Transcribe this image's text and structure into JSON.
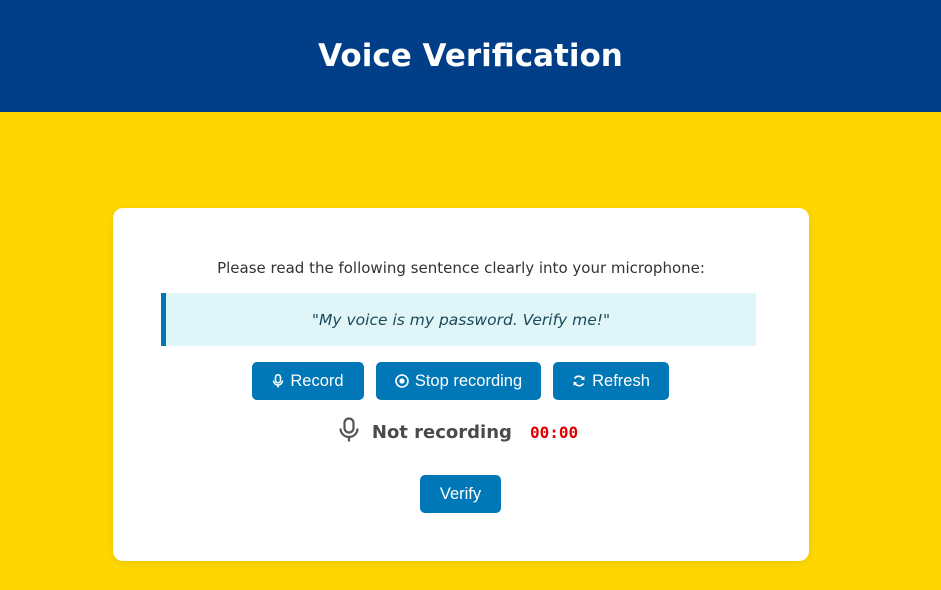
{
  "header": {
    "title": "Voice Verification"
  },
  "card": {
    "instruction": "Please read the following sentence clearly into your microphone:",
    "sentence": "\"My voice is my password. Verify me!\"",
    "buttons": {
      "record": "Record",
      "stop": "Stop recording",
      "refresh": "Refresh",
      "verify": "Verify"
    },
    "status": {
      "text": "Not recording",
      "timer": "00:00"
    }
  },
  "colors": {
    "header_bg": "#003f87",
    "page_bg": "#FFD700",
    "button_bg": "#0077b6",
    "sentence_bg": "#e0f5f8",
    "timer": "#e00000"
  },
  "icons": {
    "record": "microphone-icon",
    "stop": "stop-circle-icon",
    "refresh": "refresh-icon",
    "status": "microphone-icon"
  }
}
